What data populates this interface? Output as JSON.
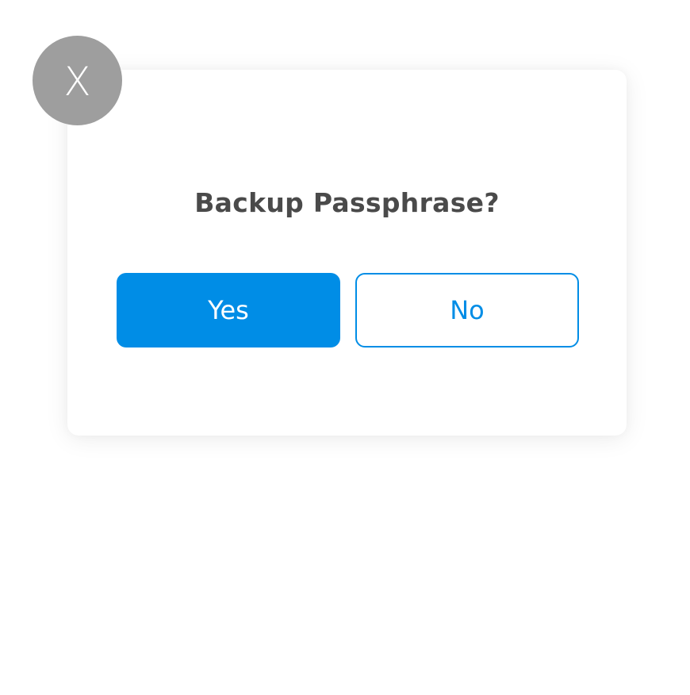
{
  "dialog": {
    "title": "Backup Passphrase?",
    "close_label": "X",
    "yes_label": "Yes",
    "no_label": "No"
  },
  "colors": {
    "primary": "#008de6",
    "close_bg": "#9e9e9e",
    "title_text": "#4a4a4a"
  }
}
